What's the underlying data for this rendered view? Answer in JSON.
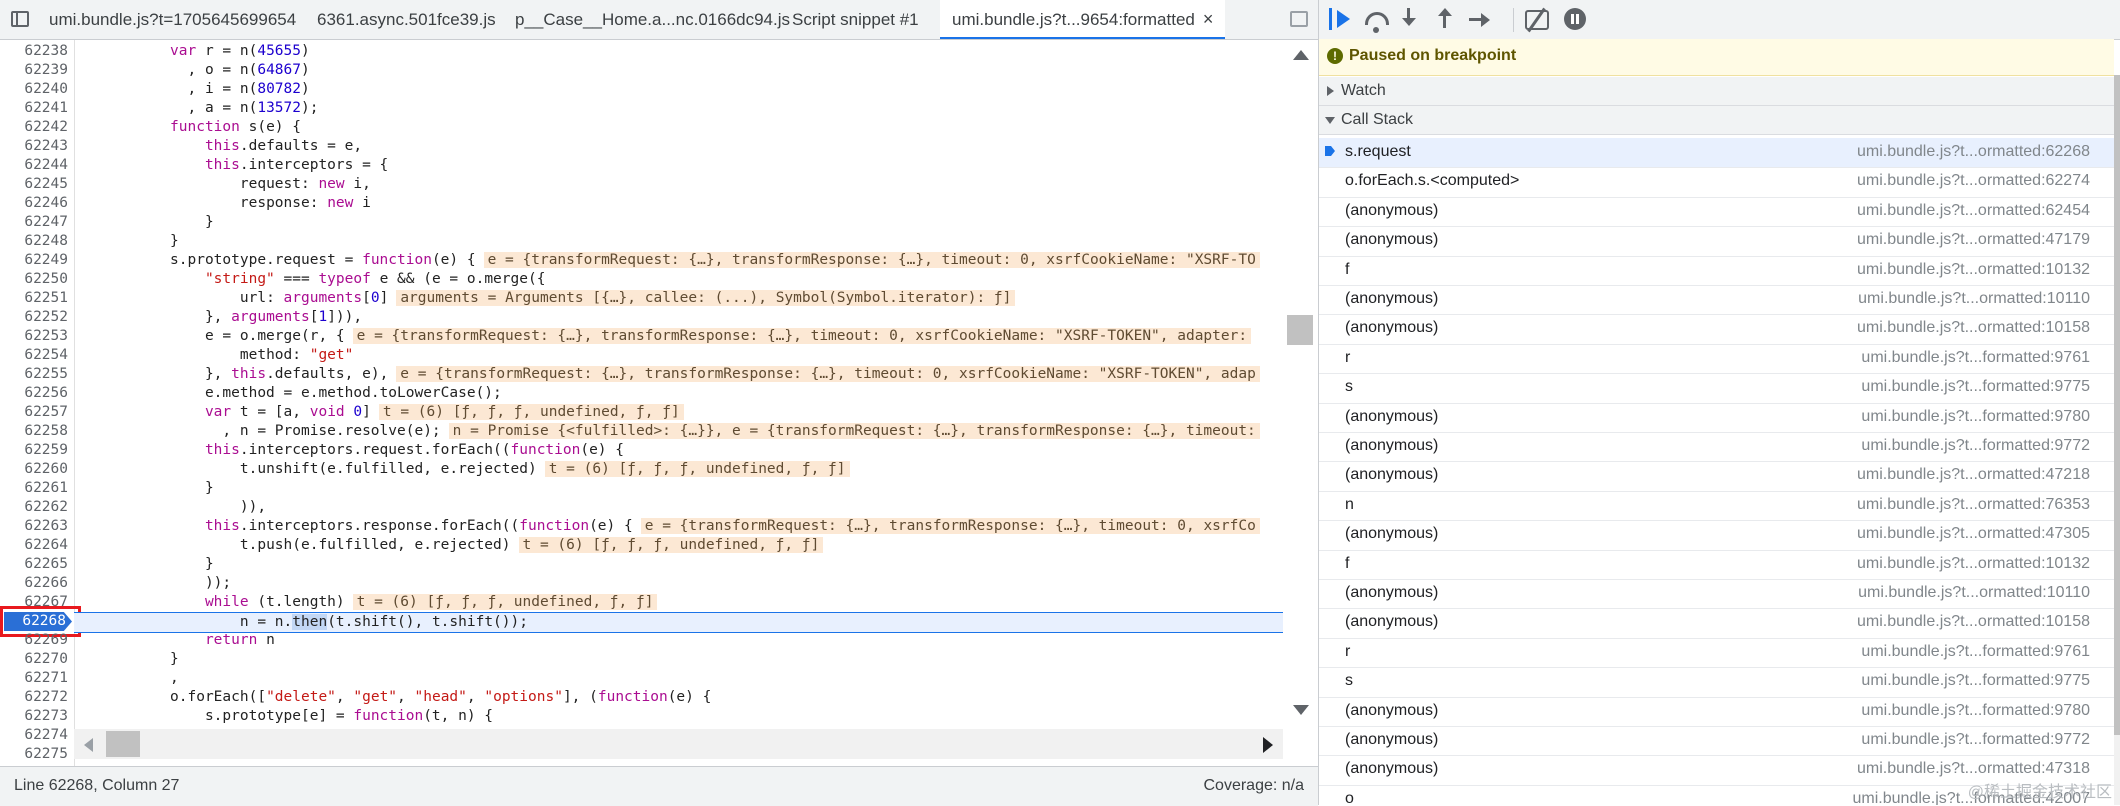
{
  "tabs": [
    {
      "label": "umi.bundle.js?t=1705645699654",
      "active": false
    },
    {
      "label": "6361.async.501fce39.js",
      "active": false
    },
    {
      "label": "p__Case__Home.a...nc.0166dc94.js",
      "active": false
    },
    {
      "label": "Script snippet #1",
      "active": false
    },
    {
      "label": "umi.bundle.js?t...9654:formatted",
      "active": true
    }
  ],
  "tab_close_glyph": "×",
  "code": {
    "lines": [
      {
        "n": "62238",
        "indent": 8,
        "segs": [
          [
            "k",
            "var"
          ],
          [
            "t",
            " r = n("
          ],
          [
            "n",
            "45655"
          ],
          [
            "t",
            ")"
          ]
        ]
      },
      {
        "n": "62239",
        "indent": 10,
        "segs": [
          [
            "t",
            ", o = n("
          ],
          [
            "n",
            "64867"
          ],
          [
            "t",
            ")"
          ]
        ]
      },
      {
        "n": "62240",
        "indent": 10,
        "segs": [
          [
            "t",
            ", i = n("
          ],
          [
            "n",
            "80782"
          ],
          [
            "t",
            ")"
          ]
        ]
      },
      {
        "n": "62241",
        "indent": 10,
        "segs": [
          [
            "t",
            ", a = n("
          ],
          [
            "n",
            "13572"
          ],
          [
            "t",
            ");"
          ]
        ]
      },
      {
        "n": "62242",
        "indent": 8,
        "segs": [
          [
            "k",
            "function"
          ],
          [
            "t",
            " s(e) {"
          ]
        ]
      },
      {
        "n": "62243",
        "indent": 12,
        "segs": [
          [
            "k",
            "this"
          ],
          [
            "t",
            ".defaults = e,"
          ]
        ]
      },
      {
        "n": "62244",
        "indent": 12,
        "segs": [
          [
            "k",
            "this"
          ],
          [
            "t",
            ".interceptors = {"
          ]
        ]
      },
      {
        "n": "62245",
        "indent": 16,
        "segs": [
          [
            "t",
            "request: "
          ],
          [
            "k",
            "new"
          ],
          [
            "t",
            " i,"
          ]
        ]
      },
      {
        "n": "62246",
        "indent": 16,
        "segs": [
          [
            "t",
            "response: "
          ],
          [
            "k",
            "new"
          ],
          [
            "t",
            " i"
          ]
        ]
      },
      {
        "n": "62247",
        "indent": 12,
        "segs": [
          [
            "t",
            "}"
          ]
        ]
      },
      {
        "n": "62248",
        "indent": 8,
        "segs": [
          [
            "t",
            "}"
          ]
        ]
      },
      {
        "n": "62249",
        "indent": 8,
        "segs": [
          [
            "t",
            "s.prototype.request = "
          ],
          [
            "k",
            "function"
          ],
          [
            "t",
            "(e) {"
          ]
        ],
        "inline": "e = {transformRequest: {…}, transformResponse: {…}, timeout: 0, xsrfCookieName: \"XSRF-TO"
      },
      {
        "n": "62250",
        "indent": 12,
        "segs": [
          [
            "s",
            "\"string\""
          ],
          [
            "t",
            " === "
          ],
          [
            "k",
            "typeof"
          ],
          [
            "t",
            " e && (e = o.merge({"
          ]
        ]
      },
      {
        "n": "62251",
        "indent": 16,
        "segs": [
          [
            "t",
            "url: "
          ],
          [
            "k",
            "arguments"
          ],
          [
            "t",
            "["
          ],
          [
            "n",
            "0"
          ],
          [
            "t",
            "]"
          ]
        ],
        "inline": "arguments = Arguments [{…}, callee: (...), Symbol(Symbol.iterator): ƒ]"
      },
      {
        "n": "62252",
        "indent": 12,
        "segs": [
          [
            "t",
            "}, "
          ],
          [
            "k",
            "arguments"
          ],
          [
            "t",
            "["
          ],
          [
            "n",
            "1"
          ],
          [
            "t",
            "])),"
          ]
        ]
      },
      {
        "n": "62253",
        "indent": 12,
        "segs": [
          [
            "t",
            "e = o.merge(r, {"
          ]
        ],
        "inline": "e = {transformRequest: {…}, transformResponse: {…}, timeout: 0, xsrfCookieName: \"XSRF-TOKEN\", adapter:"
      },
      {
        "n": "62254",
        "indent": 16,
        "segs": [
          [
            "t",
            "method: "
          ],
          [
            "s",
            "\"get\""
          ]
        ]
      },
      {
        "n": "62255",
        "indent": 12,
        "segs": [
          [
            "t",
            "}, "
          ],
          [
            "k",
            "this"
          ],
          [
            "t",
            ".defaults, e),"
          ]
        ],
        "inline": "e = {transformRequest: {…}, transformResponse: {…}, timeout: 0, xsrfCookieName: \"XSRF-TOKEN\", adap"
      },
      {
        "n": "62256",
        "indent": 12,
        "segs": [
          [
            "t",
            "e.method = e.method.toLowerCase();"
          ]
        ]
      },
      {
        "n": "62257",
        "indent": 12,
        "segs": [
          [
            "k",
            "var"
          ],
          [
            "t",
            " t = [a, "
          ],
          [
            "k",
            "void"
          ],
          [
            "t",
            " "
          ],
          [
            "n",
            "0"
          ],
          [
            "t",
            "]"
          ]
        ],
        "inline": "t = (6) [ƒ, ƒ, ƒ, undefined, ƒ, ƒ]"
      },
      {
        "n": "62258",
        "indent": 14,
        "segs": [
          [
            "t",
            ", n = Promise.resolve(e);"
          ]
        ],
        "inline": "n = Promise {<fulfilled>: {…}}, e = {transformRequest: {…}, transformResponse: {…}, timeout:"
      },
      {
        "n": "62259",
        "indent": 12,
        "segs": [
          [
            "k",
            "this"
          ],
          [
            "t",
            ".interceptors.request.forEach(("
          ],
          [
            "k",
            "function"
          ],
          [
            "t",
            "(e) {"
          ]
        ]
      },
      {
        "n": "62260",
        "indent": 16,
        "segs": [
          [
            "t",
            "t.unshift(e.fulfilled, e.rejected)"
          ]
        ],
        "inline": "t = (6) [ƒ, ƒ, ƒ, undefined, ƒ, ƒ]"
      },
      {
        "n": "62261",
        "indent": 12,
        "segs": [
          [
            "t",
            "}"
          ]
        ]
      },
      {
        "n": "62262",
        "indent": 12,
        "segs": [
          [
            "t",
            "    )),"
          ]
        ]
      },
      {
        "n": "62263",
        "indent": 12,
        "segs": [
          [
            "k",
            "this"
          ],
          [
            "t",
            ".interceptors.response.forEach(("
          ],
          [
            "k",
            "function"
          ],
          [
            "t",
            "(e) {"
          ]
        ],
        "inline": "e = {transformRequest: {…}, transformResponse: {…}, timeout: 0, xsrfCo"
      },
      {
        "n": "62264",
        "indent": 16,
        "segs": [
          [
            "t",
            "t.push(e.fulfilled, e.rejected)"
          ]
        ],
        "inline": "t = (6) [ƒ, ƒ, ƒ, undefined, ƒ, ƒ]"
      },
      {
        "n": "62265",
        "indent": 12,
        "segs": [
          [
            "t",
            "}"
          ]
        ]
      },
      {
        "n": "62266",
        "indent": 12,
        "segs": [
          [
            "t",
            "));"
          ]
        ]
      },
      {
        "n": "62267",
        "indent": 12,
        "segs": [
          [
            "k",
            "while"
          ],
          [
            "t",
            " (t.length)"
          ]
        ],
        "inline": "t = (6) [ƒ, ƒ, ƒ, undefined, ƒ, ƒ]"
      },
      {
        "n": "62268",
        "indent": 16,
        "segs": [
          [
            "t",
            "n = n."
          ],
          [
            "h",
            "then"
          ],
          [
            "t",
            "(t.shift(), t.shift());"
          ]
        ],
        "current": true
      },
      {
        "n": "62269",
        "indent": 12,
        "segs": [
          [
            "k",
            "return"
          ],
          [
            "t",
            " n"
          ]
        ]
      },
      {
        "n": "62270",
        "indent": 8,
        "segs": [
          [
            "t",
            "}"
          ]
        ]
      },
      {
        "n": "62271",
        "indent": 8,
        "segs": [
          [
            "t",
            ","
          ]
        ]
      },
      {
        "n": "62272",
        "indent": 8,
        "segs": [
          [
            "t",
            "o.forEach(["
          ],
          [
            "s",
            "\"delete\""
          ],
          [
            "t",
            ", "
          ],
          [
            "s",
            "\"get\""
          ],
          [
            "t",
            ", "
          ],
          [
            "s",
            "\"head\""
          ],
          [
            "t",
            ", "
          ],
          [
            "s",
            "\"options\""
          ],
          [
            "t",
            "], ("
          ],
          [
            "k",
            "function"
          ],
          [
            "t",
            "(e) {"
          ]
        ]
      },
      {
        "n": "62273",
        "indent": 12,
        "segs": [
          [
            "t",
            "s.prototype[e] = "
          ],
          [
            "k",
            "function"
          ],
          [
            "t",
            "(t, n) {"
          ]
        ]
      },
      {
        "n": "62274",
        "indent": 0,
        "segs": []
      },
      {
        "n": "62275",
        "indent": 0,
        "segs": []
      }
    ]
  },
  "status": {
    "position": "Line 62268, Column 27",
    "coverage": "Coverage: n/a"
  },
  "debugger": {
    "paused_icon": "!",
    "paused_text": "Paused on breakpoint",
    "watch_label": "Watch",
    "callstack_label": "Call Stack",
    "frames": [
      {
        "name": "s.request",
        "loc": "umi.bundle.js?t...ormatted:62268",
        "current": true
      },
      {
        "name": "o.forEach.s.<computed>",
        "loc": "umi.bundle.js?t...ormatted:62274"
      },
      {
        "name": "(anonymous)",
        "loc": "umi.bundle.js?t...ormatted:62454"
      },
      {
        "name": "(anonymous)",
        "loc": "umi.bundle.js?t...ormatted:47179"
      },
      {
        "name": "f",
        "loc": "umi.bundle.js?t...ormatted:10132"
      },
      {
        "name": "(anonymous)",
        "loc": "umi.bundle.js?t...ormatted:10110"
      },
      {
        "name": "(anonymous)",
        "loc": "umi.bundle.js?t...ormatted:10158"
      },
      {
        "name": "r",
        "loc": "umi.bundle.js?t...formatted:9761"
      },
      {
        "name": "s",
        "loc": "umi.bundle.js?t...formatted:9775"
      },
      {
        "name": "(anonymous)",
        "loc": "umi.bundle.js?t...formatted:9780"
      },
      {
        "name": "(anonymous)",
        "loc": "umi.bundle.js?t...formatted:9772"
      },
      {
        "name": "(anonymous)",
        "loc": "umi.bundle.js?t...ormatted:47218"
      },
      {
        "name": "n",
        "loc": "umi.bundle.js?t...ormatted:76353"
      },
      {
        "name": "(anonymous)",
        "loc": "umi.bundle.js?t...ormatted:47305"
      },
      {
        "name": "f",
        "loc": "umi.bundle.js?t...ormatted:10132"
      },
      {
        "name": "(anonymous)",
        "loc": "umi.bundle.js?t...ormatted:10110"
      },
      {
        "name": "(anonymous)",
        "loc": "umi.bundle.js?t...ormatted:10158"
      },
      {
        "name": "r",
        "loc": "umi.bundle.js?t...formatted:9761"
      },
      {
        "name": "s",
        "loc": "umi.bundle.js?t...formatted:9775"
      },
      {
        "name": "(anonymous)",
        "loc": "umi.bundle.js?t...formatted:9780"
      },
      {
        "name": "(anonymous)",
        "loc": "umi.bundle.js?t...formatted:9772"
      },
      {
        "name": "(anonymous)",
        "loc": "umi.bundle.js?t...ormatted:47318"
      },
      {
        "name": "o",
        "loc": "umi.bundle.js?t...formatted:42007"
      }
    ]
  },
  "watermark": "@稀土掘金技术社区",
  "colors": {
    "keyword": "#aa0d91",
    "string": "#c41a16",
    "number": "#1c00cf",
    "breakpoint": "#2a6fd6",
    "highlight_box": "#e8191e",
    "paused_banner": "#fffbe5"
  },
  "icons": [
    "panel-toggle-icon",
    "resume-icon",
    "step-over-icon",
    "step-into-icon",
    "step-out-icon",
    "step-icon",
    "deactivate-breakpoints-icon",
    "pause-exceptions-icon",
    "current-frame-arrow-icon"
  ]
}
